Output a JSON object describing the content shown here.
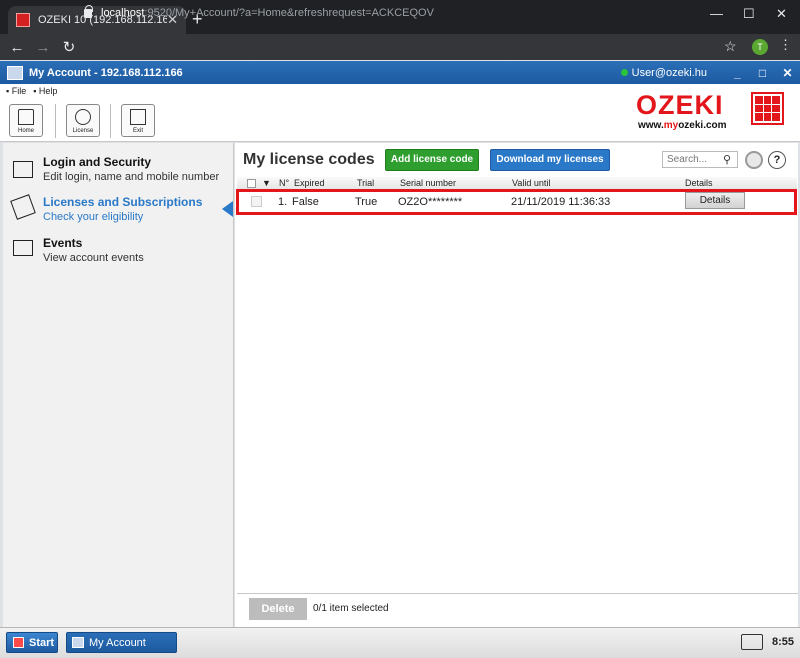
{
  "browser": {
    "tab_title": "OZEKI 10 (192.168.112.166)",
    "url_host": "localhost",
    "url_rest": ":9520/My+Account/?a=Home&refreshrequest=ACKCEQOV",
    "profile_initial": "T"
  },
  "app": {
    "title": "My Account - 192.168.112.166",
    "user": "User@ozeki.hu",
    "menu": [
      "File",
      "Help"
    ],
    "ribbon": [
      {
        "label": "Home",
        "icon": "home-icon"
      },
      {
        "label": "License",
        "icon": "key-icon"
      },
      {
        "label": "Exit",
        "icon": "exit-icon"
      }
    ],
    "logo": {
      "word": "OZEKI",
      "url_pre": "www.",
      "url_red": "my",
      "url_post": "ozeki.com"
    }
  },
  "sidebar": {
    "items": [
      {
        "title": "Login and Security",
        "subtitle": "Edit login, name and mobile number",
        "icon": "lock-icon",
        "active": false
      },
      {
        "title": "Licenses and Subscriptions",
        "subtitle": "Check your eligibility",
        "icon": "certificate-icon",
        "active": true
      },
      {
        "title": "Events",
        "subtitle": "View account events",
        "icon": "flag-icon",
        "active": false
      }
    ]
  },
  "main": {
    "title": "My license codes",
    "add_button": "Add license code",
    "download_button": "Download my licenses",
    "search_placeholder": "Search...",
    "help_label": "?",
    "columns": {
      "sort_arrow": "▼",
      "no": "N°",
      "expired": "Expired",
      "trial": "Trial",
      "serial": "Serial number",
      "valid_until": "Valid until",
      "details": "Details"
    },
    "rows": [
      {
        "no": "1.",
        "expired": "False",
        "trial": "True",
        "serial": "OZ2O********",
        "valid_until": "21/11/2019 11:36:33",
        "details_button": "Details"
      }
    ],
    "delete_button": "Delete",
    "selection_status": "0/1 item selected"
  },
  "taskbar": {
    "start_label": "Start",
    "app_label": "My Account",
    "time": "8:55"
  },
  "colors": {
    "accent": "#2a78c8",
    "brand_red": "#e3161b",
    "add_green": "#2e9e2e"
  }
}
